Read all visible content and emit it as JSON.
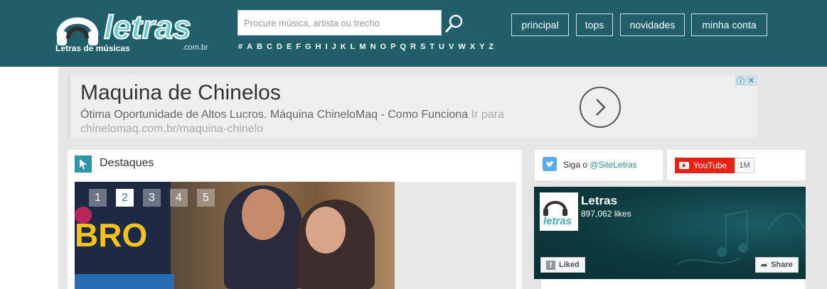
{
  "header": {
    "logo_text": "letras",
    "logo_subtitle": "Letras de músicas",
    "logo_domain": ".com.br",
    "search_placeholder": "Procure música, artista ou trecho",
    "alphabet": [
      "#",
      "A",
      "B",
      "C",
      "D",
      "E",
      "F",
      "G",
      "H",
      "I",
      "J",
      "K",
      "L",
      "M",
      "N",
      "O",
      "P",
      "Q",
      "R",
      "S",
      "T",
      "U",
      "V",
      "W",
      "X",
      "Y",
      "Z"
    ],
    "nav": [
      "principal",
      "tops",
      "novidades",
      "minha conta"
    ]
  },
  "ad": {
    "title": "Maquina de Chinelos",
    "text": "Ótima Oportunidade de Altos Lucros. Máquina ChineloMaq - Como Funciona",
    "link_text": "Ir para chinelomaq.com.br/maquina-chinelo"
  },
  "destaques": {
    "title": "Destaques",
    "pager": [
      "1",
      "2",
      "3",
      "4",
      "5"
    ],
    "active_page": "2",
    "slide_text": "BRO"
  },
  "social": {
    "twitter_prefix": "Siga o",
    "twitter_handle": "@SiteLetras",
    "youtube_label": "YouTube",
    "youtube_count": "1M",
    "facebook_name": "Letras",
    "facebook_likes": "897,062 likes",
    "facebook_logo_text": "letras",
    "liked_label": "Liked",
    "share_label": "Share"
  },
  "colors": {
    "header_bg": "#205f6a",
    "accent": "#2f96a5",
    "youtube_red": "#e62117"
  }
}
